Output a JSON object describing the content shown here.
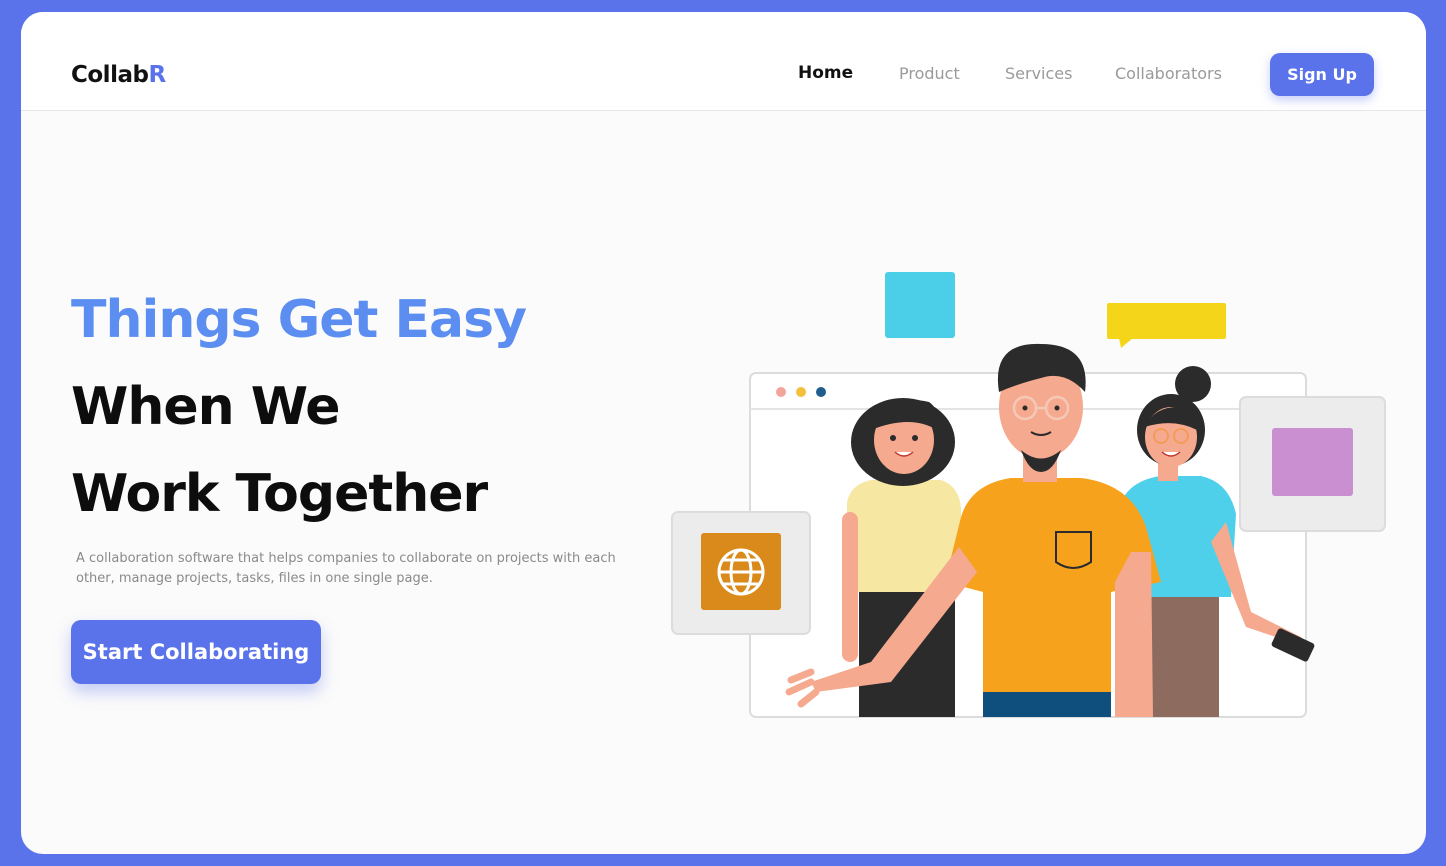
{
  "brand": {
    "name": "Collab",
    "accent_letter": "R"
  },
  "nav": {
    "items": [
      {
        "label": "Home",
        "active": true
      },
      {
        "label": "Product",
        "active": false
      },
      {
        "label": "Services",
        "active": false
      },
      {
        "label": "Collaborators",
        "active": false
      }
    ],
    "signup_label": "Sign Up"
  },
  "hero": {
    "line1": "Things Get Easy",
    "line2": "When We",
    "line3": "Work Together",
    "description": "A collaboration software that helps companies to collaborate on projects with each other, manage projects, tasks, files in one single page.",
    "cta_label": "Start Collaborating"
  },
  "colors": {
    "frame": "#5b73ea",
    "accent": "#5b73ea",
    "headline_accent": "#5b8ef0",
    "text_dark": "#0d0d0d",
    "text_muted": "#9a9a9a"
  },
  "illustration": {
    "icons": [
      "globe-icon"
    ],
    "figures": [
      "woman-yellow-shirt",
      "man-orange-shirt-glasses",
      "woman-blue-shirt-phone"
    ]
  }
}
